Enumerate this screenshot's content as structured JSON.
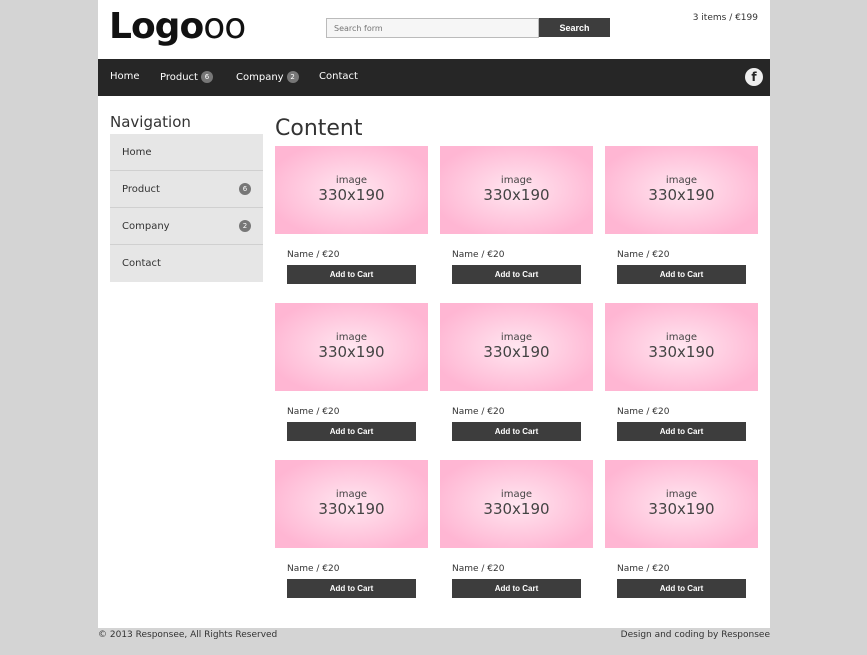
{
  "header": {
    "logo_bold": "Logo",
    "logo_light": "oo",
    "search_placeholder": "Search form",
    "search_button": "Search",
    "cart": "3 items / €199"
  },
  "nav": {
    "items": [
      {
        "label": "Home"
      },
      {
        "label": "Product",
        "badge": "6"
      },
      {
        "label": "Company",
        "badge": "2"
      },
      {
        "label": "Contact"
      }
    ],
    "social_icon": "facebook-icon",
    "social_glyph": "f"
  },
  "sidebar": {
    "title": "Navigation",
    "items": [
      {
        "label": "Home"
      },
      {
        "label": "Product",
        "badge": "6"
      },
      {
        "label": "Company",
        "badge": "2"
      },
      {
        "label": "Contact"
      }
    ]
  },
  "content": {
    "title": "Content",
    "products": [
      {
        "img1": "image",
        "img2": "330x190",
        "name": "Name / €20",
        "button": "Add to Cart"
      },
      {
        "img1": "image",
        "img2": "330x190",
        "name": "Name / €20",
        "button": "Add to Cart"
      },
      {
        "img1": "image",
        "img2": "330x190",
        "name": "Name / €20",
        "button": "Add to Cart"
      },
      {
        "img1": "image",
        "img2": "330x190",
        "name": "Name / €20",
        "button": "Add to Cart"
      },
      {
        "img1": "image",
        "img2": "330x190",
        "name": "Name / €20",
        "button": "Add to Cart"
      },
      {
        "img1": "image",
        "img2": "330x190",
        "name": "Name / €20",
        "button": "Add to Cart"
      },
      {
        "img1": "image",
        "img2": "330x190",
        "name": "Name / €20",
        "button": "Add to Cart"
      },
      {
        "img1": "image",
        "img2": "330x190",
        "name": "Name / €20",
        "button": "Add to Cart"
      },
      {
        "img1": "image",
        "img2": "330x190",
        "name": "Name / €20",
        "button": "Add to Cart"
      }
    ]
  },
  "footer": {
    "left": "© 2013 Responsee, All Rights Reserved",
    "right": "Design and coding by Responsee"
  }
}
